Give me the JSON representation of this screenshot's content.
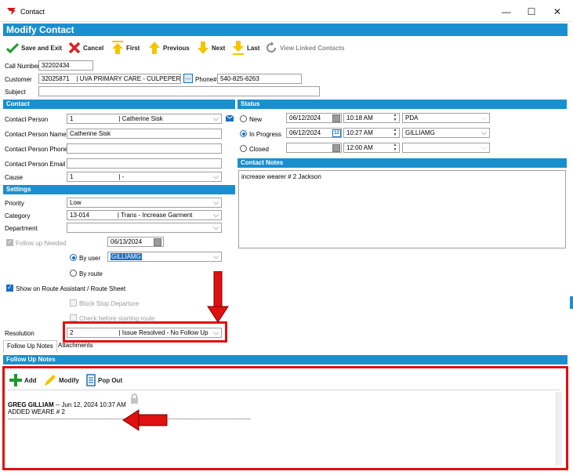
{
  "window": {
    "title": "Contact",
    "minimize": "—",
    "maximize": "☐",
    "close": "✕"
  },
  "header": {
    "title": "Modify Contact"
  },
  "toolbar": {
    "save_exit": "Save and Exit",
    "cancel": "Cancel",
    "first": "First",
    "previous": "Previous",
    "next": "Next",
    "last": "Last",
    "view_linked": "View Linked Contacts"
  },
  "top": {
    "call_number_label": "Call Number",
    "call_number": "32202434",
    "customer_label": "Customer",
    "customer_id": "32025871",
    "customer_name": "| UVA PRIMARY CARE - CULPEPER",
    "lookup": "...",
    "phone_label": "Phone#",
    "phone": "540-825-6263",
    "subject_label": "Subject",
    "subject": ""
  },
  "contact": {
    "section": "Contact",
    "person_label": "Contact Person",
    "person_id": "1",
    "person_name": "| Catherine Sisk",
    "name_label": "Contact Person Name",
    "name": "Catherine Sisk",
    "phone_label": "Contact Person Phone",
    "phone": "",
    "email_label": "Contact Person Email",
    "email": "",
    "cause_label": "Cause",
    "cause_id": "1",
    "cause_name": "| -"
  },
  "settings": {
    "section": "Settings",
    "priority_label": "Priority",
    "priority": "Low",
    "category_label": "Category",
    "category_id": "13-014",
    "category_name": "| Trans - Increase Garment",
    "department_label": "Department",
    "department": "",
    "follow_up_label": "Follow up Needed",
    "follow_up_date": "06/13/2024",
    "by_user_label": "By user",
    "by_user_value": "GILLIAMG",
    "by_route_label": "By route",
    "show_route_label": "Show on Route Assistant / Route Sheet",
    "block_stop_label": "Block Stop Departure",
    "check_before_label": "Check before starting route",
    "resolution_label": "Resolution",
    "resolution_id": "2",
    "resolution_name": "| Issue Resolved - No Follow Up"
  },
  "status": {
    "section": "Status",
    "new_label": "New",
    "new_date": "06/12/2024",
    "new_time": "10:18 AM",
    "new_user": "PDA",
    "inprogress_label": "In Progress",
    "inprogress_date": "06/12/2024",
    "inprogress_time": "10:27 AM",
    "inprogress_user": "GILLIAMG",
    "closed_label": "Closed",
    "closed_date": "",
    "closed_time": "12:00 AM",
    "closed_user": "",
    "cal_day": "12"
  },
  "notes": {
    "section": "Contact Notes",
    "text": "increase wearer # 2 Jackson"
  },
  "tabs": {
    "follow_up": "Follow Up Notes",
    "attachments": "Attachments"
  },
  "followup": {
    "section": "Follow Up Notes",
    "add": "Add",
    "modify": "Modify",
    "popout": "Pop Out",
    "entry_author": "GREG GILLIAM",
    "entry_meta": " -- Jun 12, 2024 10:37 AM",
    "entry_text": "ADDED WEARE # 2",
    "entry_rule": "-----------------------------------------------------------------------------------------------------------------------------------------------------------"
  },
  "colors": {
    "accent": "#1a8fd0",
    "annotation": "#e01010",
    "check_green": "#1c9a2e",
    "cancel_red": "#e02020",
    "arrow_yellow": "#f5c400"
  }
}
